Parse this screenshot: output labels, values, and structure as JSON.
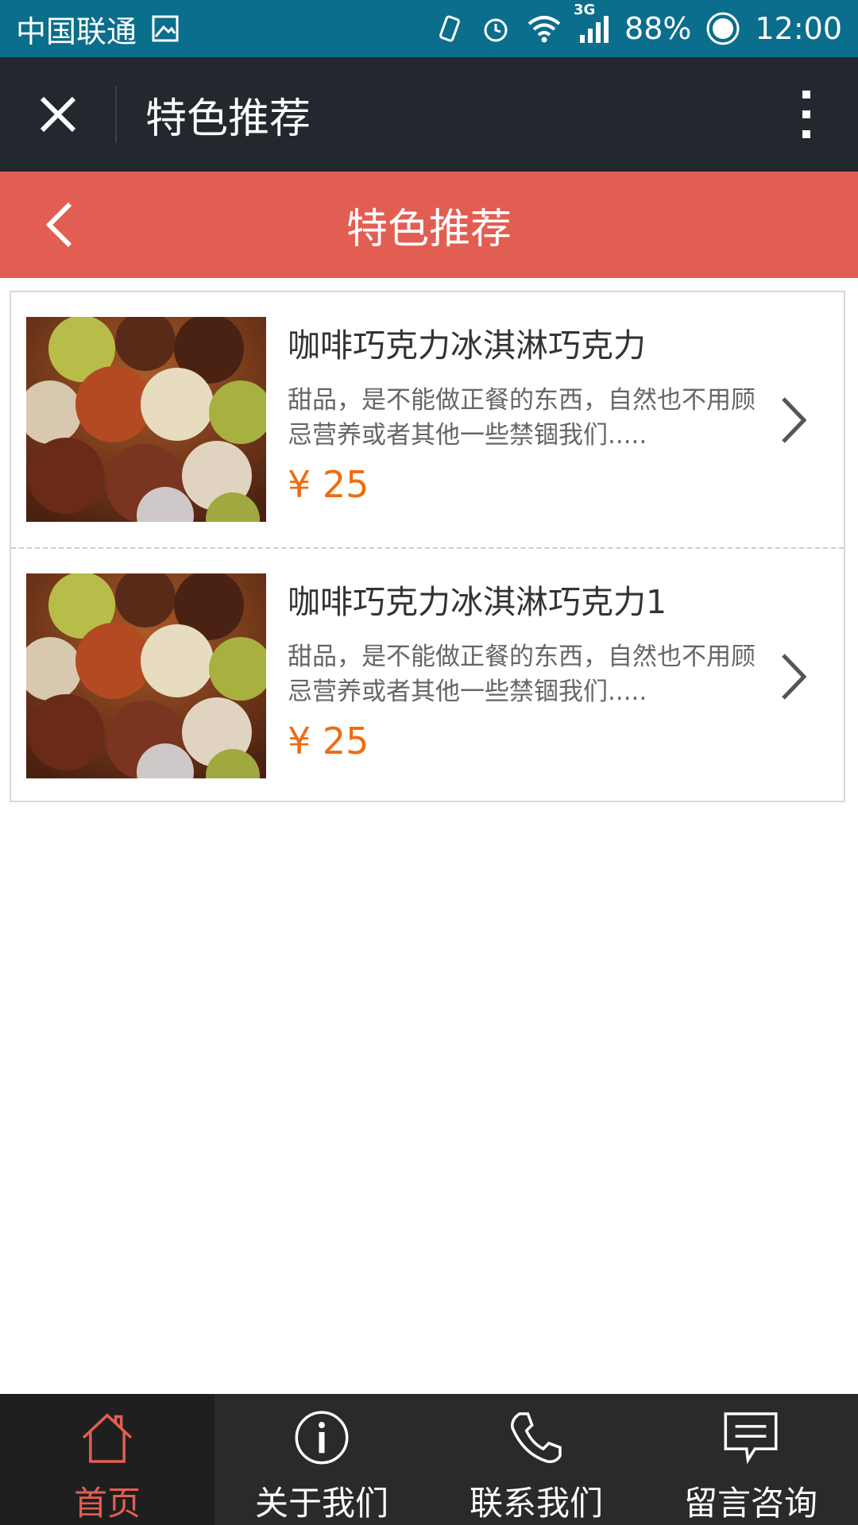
{
  "status_bar": {
    "carrier": "中国联通",
    "network": "3G",
    "battery": "88%",
    "time": "12:00"
  },
  "app_bar": {
    "title": "特色推荐",
    "icons": [
      "close-icon",
      "more-icon"
    ]
  },
  "page_header": {
    "title": "特色推荐"
  },
  "products": [
    {
      "title": "咖啡巧克力冰淇淋巧克力",
      "desc": "甜品，是不能做正餐的东西，自然也不用顾忌营养或者其他一些禁锢我们.....",
      "price": "¥ 25"
    },
    {
      "title": "咖啡巧克力冰淇淋巧克力1",
      "desc": "甜品，是不能做正餐的东西，自然也不用顾忌营养或者其他一些禁锢我们.....",
      "price": "¥ 25"
    }
  ],
  "bottom_nav": [
    {
      "label": "首页",
      "icon": "home-icon",
      "active": true
    },
    {
      "label": "关于我们",
      "icon": "info-icon",
      "active": false
    },
    {
      "label": "联系我们",
      "icon": "phone-icon",
      "active": false
    },
    {
      "label": "留言咨询",
      "icon": "message-icon",
      "active": false
    }
  ],
  "colors": {
    "status_bar": "#0a6e8c",
    "app_bar": "#22282d",
    "header": "#e25e52",
    "price": "#ef6c12",
    "nav_bg": "#2a2a2a",
    "nav_active": "#e25e52"
  }
}
